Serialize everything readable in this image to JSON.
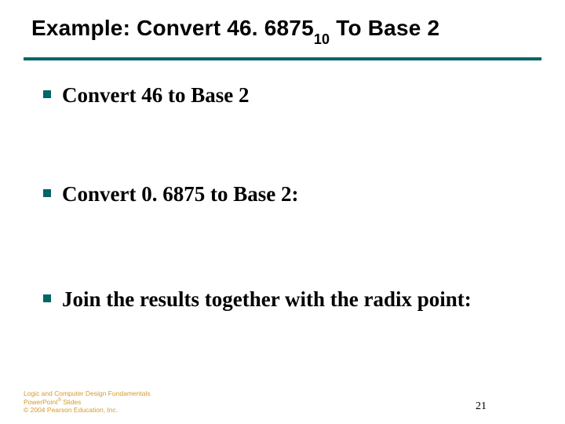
{
  "title": {
    "prefix": "Example: Convert 46. 6875",
    "subscript": "10",
    "suffix": "  To Base 2"
  },
  "bullets": [
    "Convert 46 to Base 2",
    "Convert 0. 6875 to Base 2:",
    "Join the results together with the radix point:"
  ],
  "footer": {
    "line1_a": "Logic and Computer Design Fundamentals",
    "line2_a": "PowerPoint",
    "line2_sup": "®",
    "line2_b": " Slides",
    "line3": "© 2004 Pearson Education, Inc."
  },
  "page_number": "21"
}
